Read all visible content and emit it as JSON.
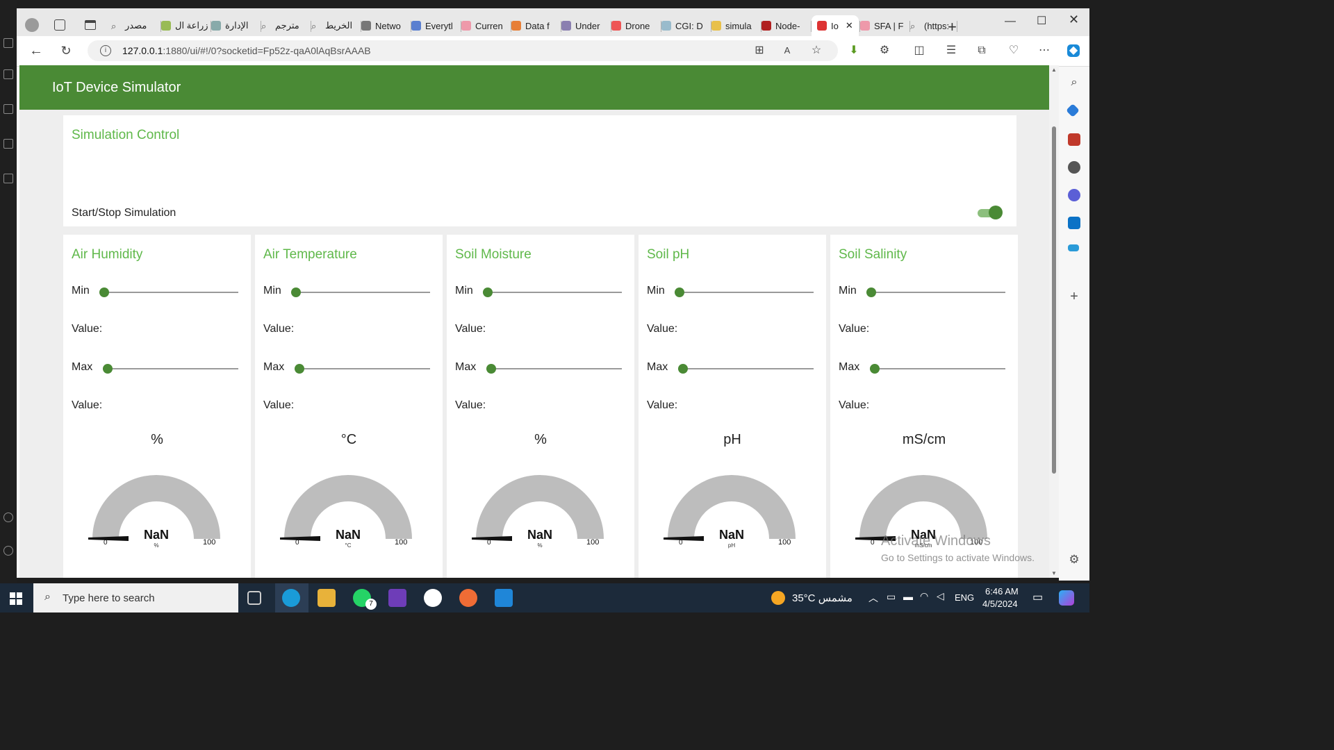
{
  "browser": {
    "tabs": [
      {
        "label": "مصدر",
        "icon": "search-icon"
      },
      {
        "label": "زراعة ال",
        "icon": "site-icon"
      },
      {
        "label": "الإدارة",
        "icon": "site-icon"
      },
      {
        "label": "مترجم",
        "icon": "search-icon"
      },
      {
        "label": "الخريط",
        "icon": "search-icon"
      },
      {
        "label": "Netwo",
        "icon": "site-icon"
      },
      {
        "label": "Everytl",
        "icon": "site-icon"
      },
      {
        "label": "Curren",
        "icon": "site-icon"
      },
      {
        "label": "Data f",
        "icon": "site-icon"
      },
      {
        "label": "Under",
        "icon": "site-icon"
      },
      {
        "label": "Drone",
        "icon": "site-icon"
      },
      {
        "label": "CGI: D",
        "icon": "site-icon"
      },
      {
        "label": "simula",
        "icon": "site-icon"
      },
      {
        "label": "Node-",
        "icon": "site-icon"
      },
      {
        "label": "Io",
        "icon": "node-red-icon",
        "active": true
      },
      {
        "label": "SFA | F",
        "icon": "site-icon"
      },
      {
        "label": "(https:",
        "icon": "search-icon"
      }
    ],
    "url_host": "127.0.0.1",
    "url_rest": ":1880/ui/#!/0?socketid=Fp52z-qaA0lAqBsrAAAB"
  },
  "app": {
    "title": "IoT Device Simulator",
    "control": {
      "title": "Simulation Control",
      "toggle_label": "Start/Stop Simulation",
      "toggle_on": true
    },
    "sensors": [
      {
        "title": "Air Humidity",
        "min_label": "Min",
        "max_label": "Max",
        "value_label": "Value:",
        "unit": "%",
        "gauge_value": "NaN",
        "gauge_min": "0",
        "gauge_max": "100",
        "gauge_unit": "%"
      },
      {
        "title": "Air Temperature",
        "min_label": "Min",
        "max_label": "Max",
        "value_label": "Value:",
        "unit": "°C",
        "gauge_value": "NaN",
        "gauge_min": "0",
        "gauge_max": "100",
        "gauge_unit": "°C"
      },
      {
        "title": "Soil Moisture",
        "min_label": "Min",
        "max_label": "Max",
        "value_label": "Value:",
        "unit": "%",
        "gauge_value": "NaN",
        "gauge_min": "0",
        "gauge_max": "100",
        "gauge_unit": "%"
      },
      {
        "title": "Soil pH",
        "min_label": "Min",
        "max_label": "Max",
        "value_label": "Value:",
        "unit": "pH",
        "gauge_value": "NaN",
        "gauge_min": "0",
        "gauge_max": "100",
        "gauge_unit": "pH"
      },
      {
        "title": "Soil Salinity",
        "min_label": "Min",
        "max_label": "Max",
        "value_label": "Value:",
        "unit": "mS/cm",
        "gauge_value": "NaN",
        "gauge_min": "0",
        "gauge_max": "100",
        "gauge_unit": "mS/cm"
      }
    ]
  },
  "watermark": {
    "line1": "Activate Windows",
    "line2": "Go to Settings to activate Windows."
  },
  "taskbar": {
    "search_placeholder": "Type here to search",
    "weather": "35°C  مشمس",
    "lang": "ENG",
    "time": "6:46 AM",
    "date": "4/5/2024",
    "whatsapp_badge": "7"
  },
  "colors": {
    "header": "#4a8a35",
    "accent": "#5fb84a",
    "gauge": "#bdbdbd"
  }
}
